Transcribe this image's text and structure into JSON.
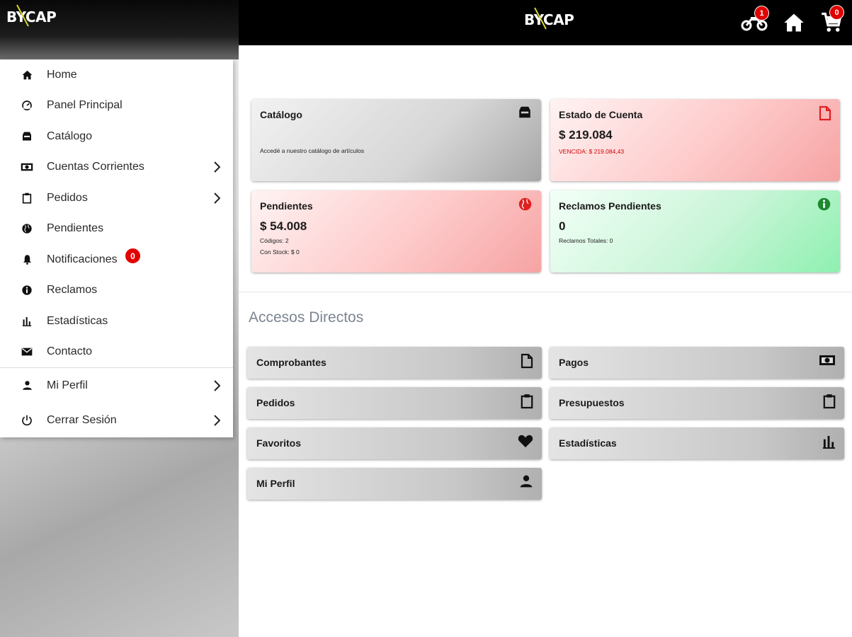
{
  "brand": {
    "logo_text": "BYCAP"
  },
  "sidebar": {
    "items": [
      {
        "label": "Home",
        "icon": "home-icon"
      },
      {
        "label": "Panel Principal",
        "icon": "dashboard-icon"
      },
      {
        "label": "Catálogo",
        "icon": "inbox-icon"
      },
      {
        "label": "Cuentas Corrientes",
        "icon": "money-icon"
      },
      {
        "label": "Pedidos",
        "icon": "clipboard-icon"
      },
      {
        "label": "Pendientes",
        "icon": "globe-icon"
      },
      {
        "label": "Notificaciones",
        "icon": "bell-icon",
        "badge": "0"
      },
      {
        "label": "Reclamos",
        "icon": "info-icon"
      },
      {
        "label": "Estadísticas",
        "icon": "bar-chart-icon"
      },
      {
        "label": "Contacto",
        "icon": "mail-icon"
      }
    ],
    "bottom_items": [
      {
        "label": "Mi Perfil",
        "icon": "person-icon"
      },
      {
        "label": "Cerrar Sesión",
        "icon": "power-icon"
      }
    ]
  },
  "topbar": {
    "moto_badge": "1",
    "cart_badge": "0"
  },
  "cards": {
    "catalogo": {
      "title": "Catálogo",
      "desc": "Accedé a nuestro catálogo de artículos"
    },
    "estado": {
      "title": "Estado de Cuenta",
      "amount": "$ 219.084",
      "vencida": "VENCIDA: $ 219.084,43"
    },
    "pendientes": {
      "title": "Pendientes",
      "amount": "$ 54.008",
      "codigos": "Códigos: 2",
      "stock": "Con Stock: $ 0"
    },
    "reclamos": {
      "title": "Reclamos Pendientes",
      "amount": "0",
      "totales": "Reclamos Totales: 0"
    }
  },
  "accesos": {
    "title": "Accesos Directos",
    "items": [
      {
        "label": "Comprobantes",
        "icon": "file-icon"
      },
      {
        "label": "Pagos",
        "icon": "money-icon"
      },
      {
        "label": "Pedidos",
        "icon": "clipboard-icon"
      },
      {
        "label": "Presupuestos",
        "icon": "clipboard-icon"
      },
      {
        "label": "Favoritos",
        "icon": "heart-icon"
      },
      {
        "label": "Estadísticas",
        "icon": "bar-chart-icon"
      },
      {
        "label": "Mi Perfil",
        "icon": "person-icon"
      }
    ]
  },
  "colors": {
    "badge": "#e10000",
    "topbar": "#000000",
    "danger_text": "#d00000",
    "info_green": "#1b8a2e"
  }
}
